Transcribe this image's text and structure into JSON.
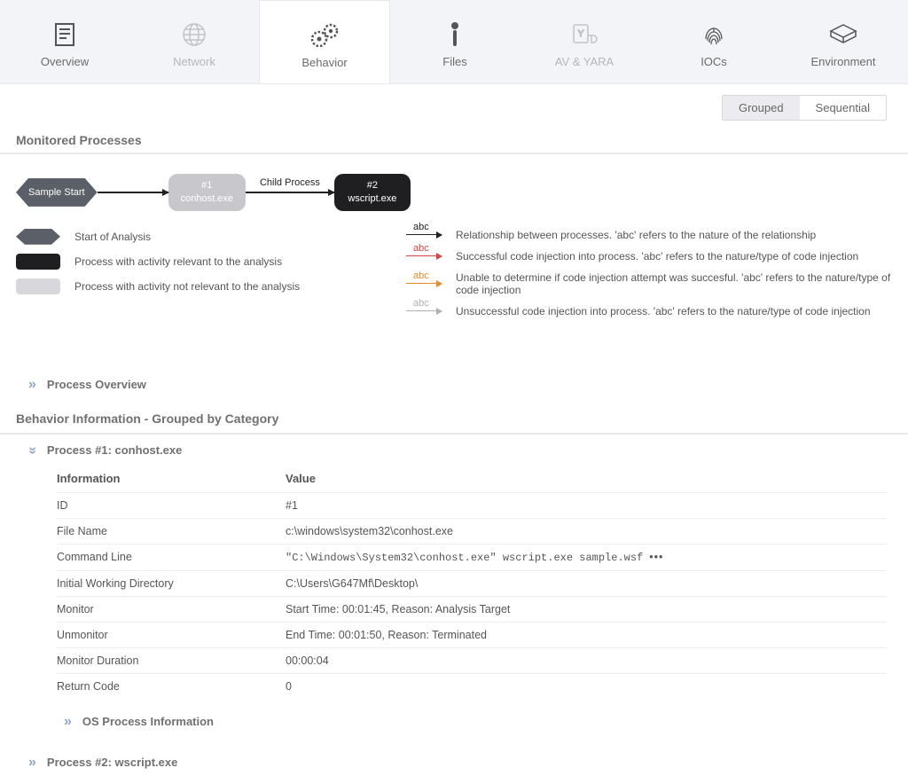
{
  "tabs": {
    "overview": "Overview",
    "network": "Network",
    "behavior": "Behavior",
    "files": "Files",
    "av_yara": "AV & YARA",
    "iocs": "IOCs",
    "environment": "Environment"
  },
  "toggle": {
    "grouped": "Grouped",
    "sequential": "Sequential"
  },
  "sections": {
    "monitored": "Monitored Processes",
    "proc_overview": "Process Overview",
    "beh_title": "Behavior Information - Grouped by Category",
    "os_proc_info": "OS Process Information"
  },
  "graph": {
    "sample_start": "Sample Start",
    "child_process": "Child Process",
    "n1_id": "#1",
    "n1_name": "conhost.exe",
    "n2_id": "#2",
    "n2_name": "wscript.exe"
  },
  "legend_left": {
    "start": "Start of Analysis",
    "relevant": "Process with activity relevant to the analysis",
    "not_relevant": "Process with activity not relevant to the analysis"
  },
  "legend_right": {
    "abc": "abc",
    "rel": "Relationship between processes. 'abc' refers to the nature of the relationship",
    "succ": "Successful code injection into process. 'abc' refers to the nature/type of code injection",
    "unable": "Unable to determine if code injection attempt was succesful. 'abc' refers to the nature/type of code injection",
    "unsucc": "Unsuccessful code injection into process. 'abc' refers to the nature/type of code injection"
  },
  "proc1": {
    "title": "Process #1: conhost.exe",
    "headers": {
      "info": "Information",
      "val": "Value"
    },
    "rows": {
      "id_k": "ID",
      "id_v": "#1",
      "fn_k": "File Name",
      "fn_v": "c:\\windows\\system32\\conhost.exe",
      "cl_k": "Command Line",
      "cl_v": "\"C:\\Windows\\System32\\conhost.exe\" wscript.exe sample.wsf",
      "cl_more": "•••",
      "iwd_k": "Initial Working Directory",
      "iwd_v": "C:\\Users\\G647Mf\\Desktop\\",
      "mon_k": "Monitor",
      "mon_v": "Start Time: 00:01:45, Reason: Analysis Target",
      "unmon_k": "Unmonitor",
      "unmon_v": "End Time: 00:01:50, Reason: Terminated",
      "dur_k": "Monitor Duration",
      "dur_v": "00:00:04",
      "rc_k": "Return Code",
      "rc_v": "0"
    }
  },
  "proc2": {
    "title": "Process #2: wscript.exe"
  }
}
